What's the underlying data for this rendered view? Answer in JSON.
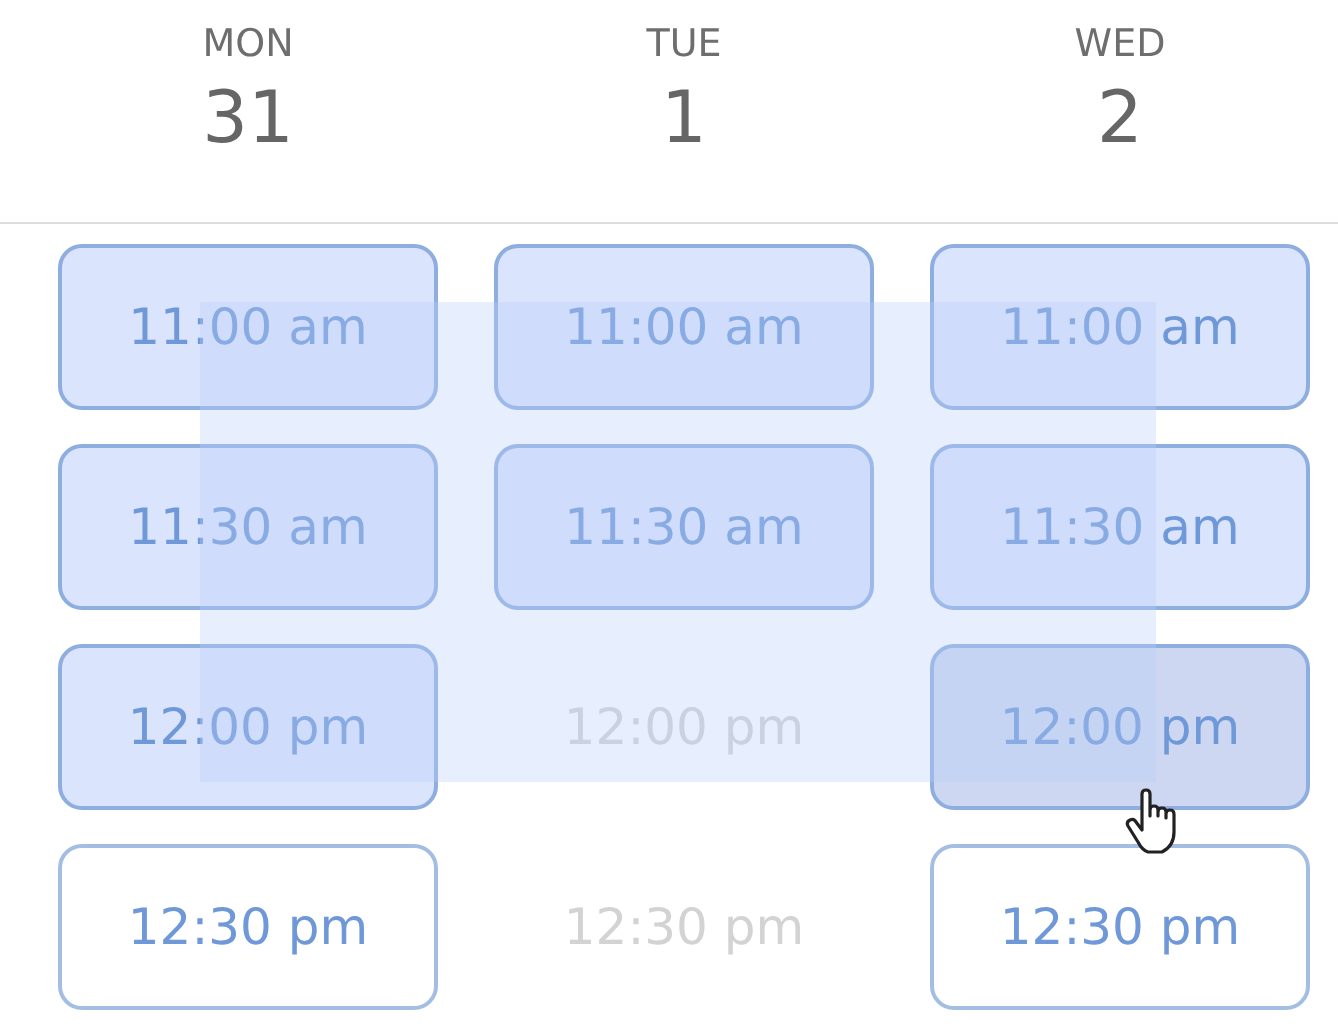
{
  "days": [
    {
      "day": "MON",
      "date": "31",
      "slots": [
        {
          "time": "11:00 am",
          "selected": true,
          "disabled": false,
          "hovered": false
        },
        {
          "time": "11:30 am",
          "selected": true,
          "disabled": false,
          "hovered": false
        },
        {
          "time": "12:00 pm",
          "selected": true,
          "disabled": false,
          "hovered": false
        },
        {
          "time": "12:30 pm",
          "selected": false,
          "disabled": false,
          "hovered": false
        }
      ]
    },
    {
      "day": "TUE",
      "date": "1",
      "slots": [
        {
          "time": "11:00 am",
          "selected": true,
          "disabled": false,
          "hovered": false
        },
        {
          "time": "11:30 am",
          "selected": true,
          "disabled": false,
          "hovered": false
        },
        {
          "time": "12:00 pm",
          "selected": false,
          "disabled": true,
          "hovered": false
        },
        {
          "time": "12:30 pm",
          "selected": false,
          "disabled": true,
          "hovered": false
        }
      ]
    },
    {
      "day": "WED",
      "date": "2",
      "slots": [
        {
          "time": "11:00 am",
          "selected": true,
          "disabled": false,
          "hovered": false
        },
        {
          "time": "11:30 am",
          "selected": true,
          "disabled": false,
          "hovered": false
        },
        {
          "time": "12:00 pm",
          "selected": true,
          "disabled": false,
          "hovered": true
        },
        {
          "time": "12:30 pm",
          "selected": false,
          "disabled": false,
          "hovered": false
        }
      ]
    }
  ]
}
